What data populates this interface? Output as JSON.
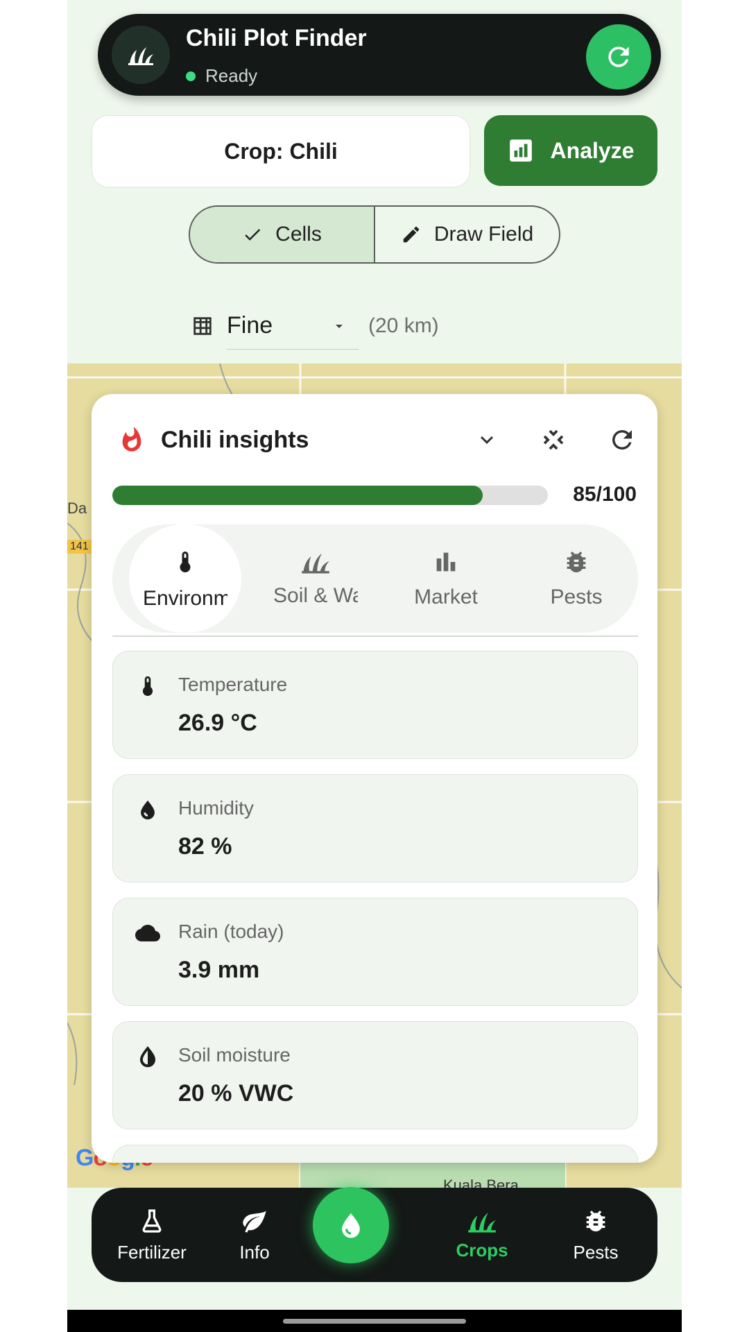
{
  "app": {
    "title": "Chili Plot Finder",
    "status": "Ready"
  },
  "controls": {
    "crop": "Crop: Chili",
    "analyze": "Analyze"
  },
  "mode": {
    "cells": "Cells",
    "draw_field": "Draw Field"
  },
  "resolution": {
    "value": "Fine",
    "note": "(20 km)"
  },
  "map": {
    "label_da": "Da",
    "road_141": "141",
    "place": "Kuala Bera",
    "google": [
      "G",
      "o",
      "o",
      "g",
      "l",
      "e"
    ]
  },
  "insights": {
    "title": "Chili insights",
    "score_text": "85/100",
    "score": 85,
    "tabs": [
      "Environment",
      "Soil & Water",
      "Market",
      "Pests"
    ],
    "metrics": [
      {
        "label": "Temperature",
        "value": "26.9 °C",
        "icon": "thermometer-icon"
      },
      {
        "label": "Humidity",
        "value": "82 %",
        "icon": "water-drop-icon"
      },
      {
        "label": "Rain (today)",
        "value": "3.9 mm",
        "icon": "cloud-icon"
      },
      {
        "label": "Soil moisture",
        "value": "20 % VWC",
        "icon": "contrast-drop-icon"
      }
    ]
  },
  "nav": {
    "fertilizer": "Fertilizer",
    "info": "Info",
    "crops": "Crops",
    "pests": "Pests"
  },
  "colors": {
    "accent": "#2e7d32",
    "fab": "#2dc45f",
    "active_nav": "#2ecc63",
    "bar_bg": "#141816"
  }
}
